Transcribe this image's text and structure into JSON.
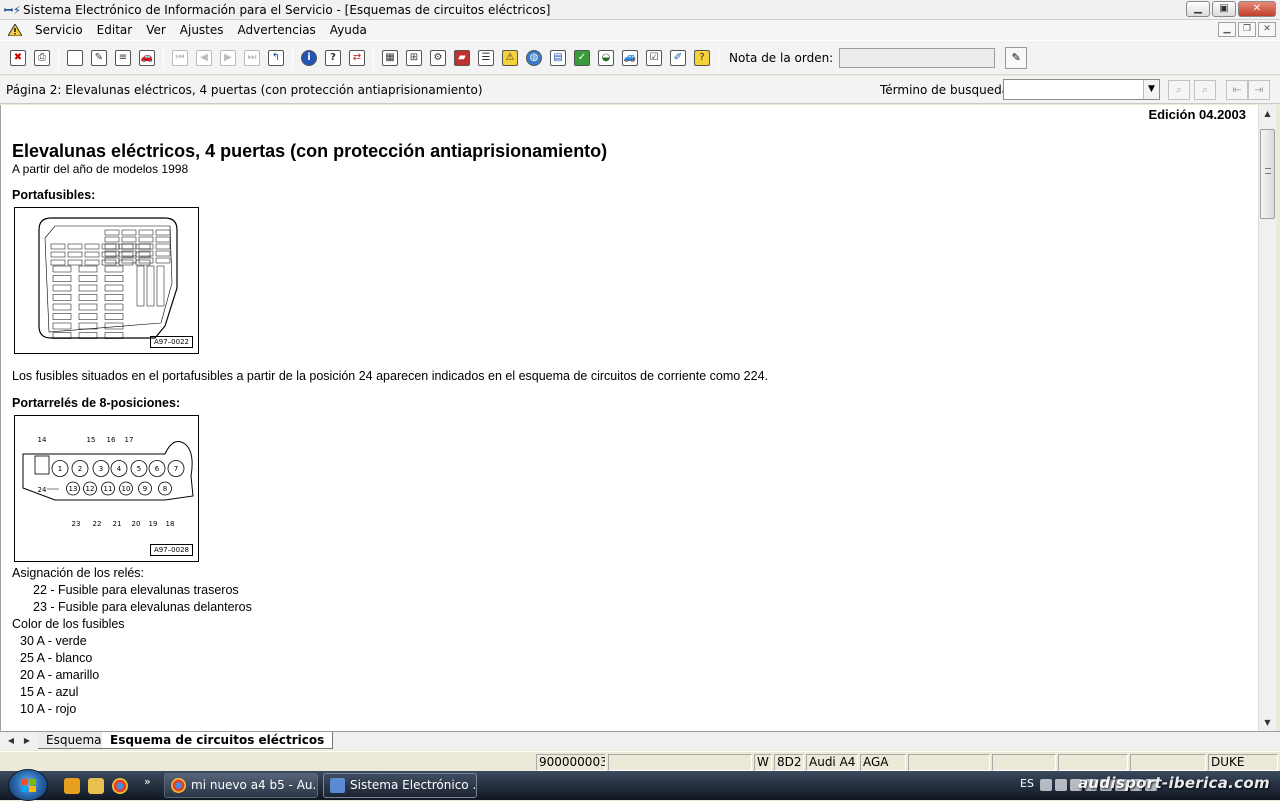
{
  "window": {
    "title": "Sistema Electrónico de Información para el Servicio - [Esquemas de circuitos eléctricos]",
    "buttons": {
      "minimize": "▁",
      "maximize": "▣",
      "close": "✕"
    }
  },
  "menu": {
    "items": [
      "Servicio",
      "Editar",
      "Ver",
      "Ajustes",
      "Advertencias",
      "Ayuda"
    ]
  },
  "toolbar": {
    "note_label": "Nota de la orden:",
    "note_value": ""
  },
  "pagebar": {
    "page_info": "Página 2: Elevalunas eléctricos, 4 puertas (con protección antiaprisionamiento)",
    "search_label": "Término de busqueda:",
    "search_value": ""
  },
  "document": {
    "edition": "Edición 04.2003",
    "title": "Elevalunas eléctricos, 4 puertas (con protección antiaprisionamiento)",
    "subtitle": "A partir del año de modelos 1998",
    "fuse_heading": "Portafusibles:",
    "fuse_figure_tag": "A97–0022",
    "fuse_paragraph": "Los fusibles situados en el portafusibles a partir de la posición 24 aparecen indicados en el esquema de circuitos de corriente como 224.",
    "relay_heading": "Portarrelés de 8-posiciones:",
    "relay_figure_tag": "A97–0028",
    "relay_figure_labels": {
      "top": [
        "14",
        "15",
        "16",
        "17"
      ],
      "row1": [
        "1",
        "2",
        "3",
        "4",
        "5",
        "6",
        "7"
      ],
      "row2": [
        "13",
        "12",
        "11",
        "10",
        "9",
        "8"
      ],
      "left": "24",
      "bottom": [
        "23",
        "22",
        "21",
        "20",
        "19",
        "18"
      ]
    },
    "relay_assignment_heading": "Asignación de los relés:",
    "relay_assignments": [
      "22 - Fusible para elevalunas traseros",
      "23 - Fusible para elevalunas delanteros"
    ],
    "fuse_color_heading": "Color de los fusibles",
    "fuse_colors": [
      "30 A - verde",
      "25 A - blanco",
      "20 A - amarillo",
      "15 A - azul",
      "10 A - rojo"
    ]
  },
  "tabs": [
    {
      "label": "Esquema",
      "active": false
    },
    {
      "label": "Esquema de circuitos eléctricos",
      "active": true
    }
  ],
  "statusbar": {
    "order": "9000000034",
    "cells": [
      "W",
      "8D2",
      "Audi A4",
      "AGA"
    ],
    "user": "DUKE"
  },
  "taskbar": {
    "tasks": [
      {
        "label": "mi nuevo a4 b5 - Au...",
        "active": false
      },
      {
        "label": "Sistema Electrónico ...",
        "active": true
      }
    ],
    "lang": "ES",
    "watermark": "audisport-iberica.com"
  }
}
